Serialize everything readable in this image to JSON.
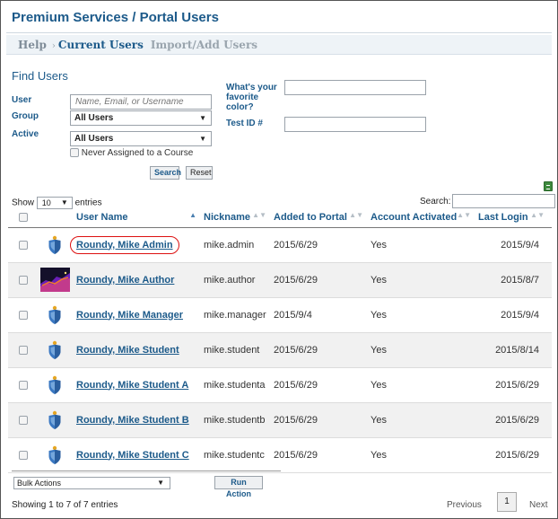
{
  "header": {
    "title": "Premium Services / Portal Users"
  },
  "subnav": {
    "help": "Help",
    "separator": "›",
    "current": "Current Users",
    "import": "Import/Add Users"
  },
  "find": {
    "title": "Find Users",
    "user_label": "User",
    "user_placeholder": "Name, Email, or Username",
    "group_label": "Group",
    "group_value": "All Users",
    "active_label": "Active",
    "active_value": "All Users",
    "never_assigned": "Never Assigned to a Course",
    "search_button": "Search",
    "reset_button": "Reset",
    "color_label": "What's your favorite color?",
    "test_id_label": "Test ID #"
  },
  "table_controls": {
    "show_label": "Show",
    "show_value": "10",
    "entries_label": "entries",
    "search_label": "Search:"
  },
  "columns": [
    "User Name",
    "Nickname",
    "Added to Portal",
    "Account Activated",
    "Last Login"
  ],
  "rows": [
    {
      "icon": "shield-icon",
      "name": "Roundy, Mike Admin",
      "nickname": "mike.admin",
      "added": "2015/6/29",
      "activated": "Yes",
      "last_login": "2015/9/4"
    },
    {
      "icon": "author-photo",
      "name": "Roundy, Mike Author",
      "nickname": "mike.author",
      "added": "2015/6/29",
      "activated": "Yes",
      "last_login": "2015/8/7"
    },
    {
      "icon": "shield-icon",
      "name": "Roundy, Mike Manager",
      "nickname": "mike.manager",
      "added": "2015/9/4",
      "activated": "Yes",
      "last_login": "2015/9/4"
    },
    {
      "icon": "shield-icon",
      "name": "Roundy, Mike Student",
      "nickname": "mike.student",
      "added": "2015/6/29",
      "activated": "Yes",
      "last_login": "2015/8/14"
    },
    {
      "icon": "shield-icon",
      "name": "Roundy, Mike Student A",
      "nickname": "mike.studenta",
      "added": "2015/6/29",
      "activated": "Yes",
      "last_login": "2015/6/29"
    },
    {
      "icon": "shield-icon",
      "name": "Roundy, Mike Student B",
      "nickname": "mike.studentb",
      "added": "2015/6/29",
      "activated": "Yes",
      "last_login": "2015/6/29"
    },
    {
      "icon": "shield-icon",
      "name": "Roundy, Mike Student C",
      "nickname": "mike.studentc",
      "added": "2015/6/29",
      "activated": "Yes",
      "last_login": "2015/6/29"
    }
  ],
  "bulk": {
    "select_value": "Bulk Actions",
    "run_button": "Run Action"
  },
  "footer": {
    "showing": "Showing 1 to 7 of 7 entries",
    "previous": "Previous",
    "page": "1",
    "next": "Next"
  },
  "colors": {
    "accent": "#1c5a8a",
    "highlight_circle": "#dd1111"
  }
}
